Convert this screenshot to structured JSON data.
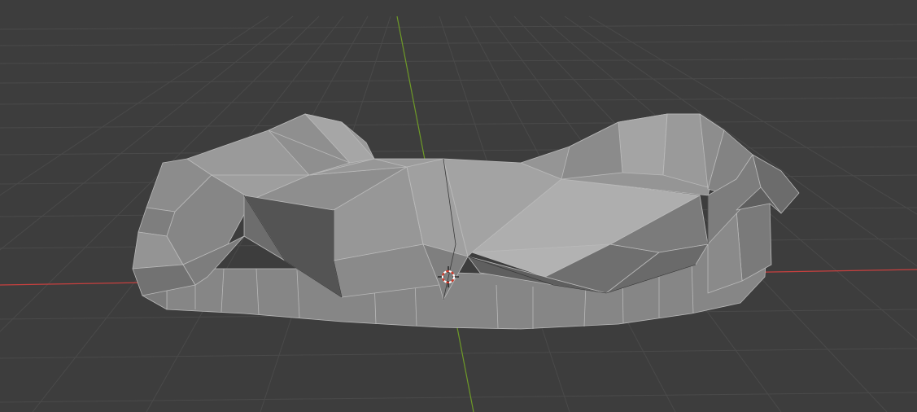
{
  "viewport": {
    "kind": "3d-viewport",
    "background_color": "#3d3d3d",
    "grid_color": "#4a4a4a",
    "x_axis_color": "#c8403f",
    "y_axis_color": "#6e9a28",
    "mesh_color": "#8f8f8f",
    "cursor_icon": "3d-cursor-icon"
  }
}
